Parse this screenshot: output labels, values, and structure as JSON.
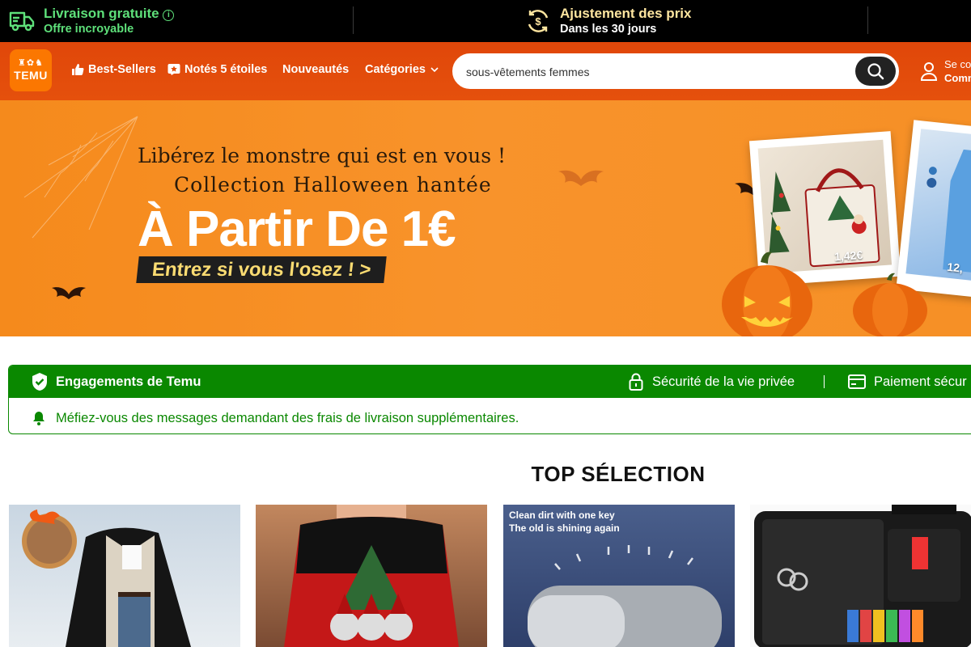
{
  "promo": {
    "shipping_title": "Livraison gratuite",
    "shipping_sub": "Offre incroyable",
    "price_title": "Ajustement des prix",
    "price_sub": "Dans les 30 jours"
  },
  "header": {
    "logo_text": "TEMU",
    "nav": [
      "Best-Sellers",
      "Notés 5 étoiles",
      "Nouveautés",
      "Catégories"
    ],
    "search_value": "sous-vêtements femmes",
    "account_line1": "Se con",
    "account_line2": "Comm"
  },
  "banner": {
    "line1": "Libérez le monstre qui est en vous !",
    "line2": "Collection Halloween hantée",
    "headline": "À Partir De 1€",
    "cta": "Entrez si vous l'osez ! >",
    "price1": "1,42€",
    "price2": "12,"
  },
  "commitment": {
    "title": "Engagements de Temu",
    "privacy": "Sécurité de la vie privée",
    "payment": "Paiement sécur",
    "warning": "Méfiez-vous des messages demandant des frais de livraison supplémentaires."
  },
  "section": {
    "title": "TOP SÉLECTION"
  },
  "products": [
    {
      "name": "coat"
    },
    {
      "name": "christmas-top"
    },
    {
      "name": "gadget",
      "line1": "Clean dirt with one key",
      "line2": "The old is shining again"
    },
    {
      "name": "sewing-kit"
    }
  ],
  "colors": {
    "brand_orange": "#fb7701",
    "header": "#e24a06",
    "green": "#0a8800"
  }
}
